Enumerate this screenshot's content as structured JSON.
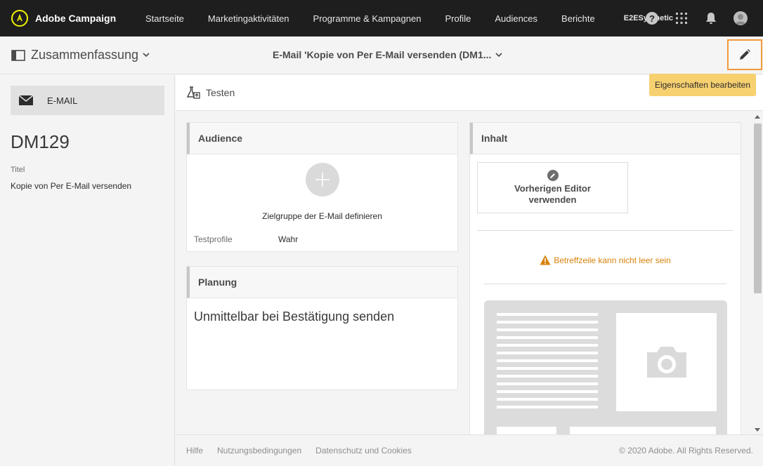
{
  "app": {
    "name": "Adobe Campaign",
    "org": "E2ESynthetic"
  },
  "nav": {
    "items": [
      {
        "label": "Startseite"
      },
      {
        "label": "Marketingaktivitäten"
      },
      {
        "label": "Programme & Kampagnen"
      },
      {
        "label": "Profile"
      },
      {
        "label": "Audiences"
      },
      {
        "label": "Berichte"
      }
    ],
    "help_symbol": "?"
  },
  "subheader": {
    "summary_label": "Zusammenfassung",
    "doc_title": "E-Mail 'Kopie von Per E-Mail versenden (DM1...",
    "edit_tooltip": "Eigenschaften bearbeiten"
  },
  "left": {
    "channel_label": "E-MAIL",
    "code": "DM129",
    "title_label": "Titel",
    "title_value": "Kopie von Per E-Mail versenden"
  },
  "toolbar": {
    "test_label": "Testen"
  },
  "audience": {
    "heading": "Audience",
    "define_label": "Zielgruppe der E-Mail definieren",
    "test_profiles_label": "Testprofile",
    "test_profiles_value": "Wahr"
  },
  "planning": {
    "heading": "Planung",
    "value": "Unmittelbar bei Bestätigung senden"
  },
  "content": {
    "heading": "Inhalt",
    "prev_editor_label": "Vorherigen Editor verwenden",
    "warning": "Betreffzeile kann nicht leer sein"
  },
  "footer": {
    "links": [
      {
        "label": "Hilfe"
      },
      {
        "label": "Nutzungsbedingungen"
      },
      {
        "label": "Datenschutz und Cookies"
      }
    ],
    "copyright": "© 2020 Adobe. All Rights Reserved."
  },
  "colors": {
    "topbar": "#1e1e1e",
    "highlight_border": "#f09a3e",
    "tooltip": "#f7d070",
    "warning": "#d7830b"
  }
}
